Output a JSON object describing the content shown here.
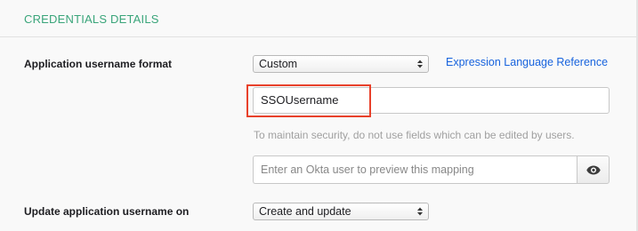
{
  "section": {
    "title": "CREDENTIALS DETAILS"
  },
  "username_format": {
    "label": "Application username format",
    "selected": "Custom",
    "reference_link": "Expression Language Reference"
  },
  "expression": {
    "value": "SSOUsername"
  },
  "hint": "To maintain security, do not use fields which can be edited by users.",
  "preview": {
    "placeholder": "Enter an Okta user to preview this mapping",
    "button_icon": "eye-icon"
  },
  "update_on": {
    "label": "Update application username on",
    "selected": "Create and update"
  },
  "colors": {
    "section_title": "#3aa57a",
    "link": "#1662dd",
    "highlight": "#e8412b"
  }
}
